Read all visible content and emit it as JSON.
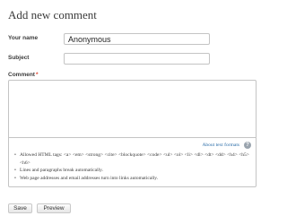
{
  "form": {
    "heading": "Add new comment",
    "name_label": "Your name",
    "name_value": "Anonymous",
    "subject_label": "Subject",
    "subject_value": "",
    "comment_label": "Comment",
    "required_marker": "*",
    "comment_value": ""
  },
  "text_format": {
    "help_link": "About text formats",
    "help_icon": "?",
    "help_icon_name": "help-icon",
    "tips": [
      "Allowed HTML tags: <a> <em> <strong> <cite> <blockquote> <code> <ul> <ol> <li> <dl> <dt> <dd> <h4> <h5> <h6>",
      "Lines and paragraphs break automatically.",
      "Web page addresses and email addresses turn into links automatically."
    ]
  },
  "actions": {
    "save": "Save",
    "preview": "Preview"
  },
  "colors": {
    "required": "#e0442f",
    "link": "#2a6ca8",
    "border": "#c4c4c4"
  }
}
